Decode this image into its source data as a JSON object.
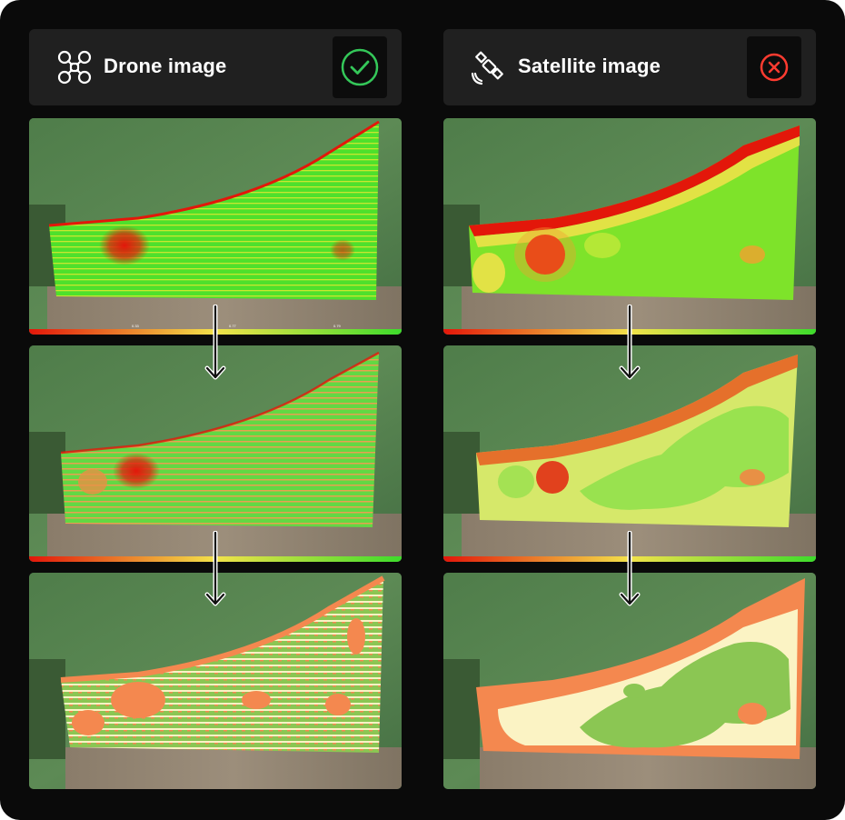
{
  "left_column": {
    "title": "Drone image",
    "icon": "drone-icon",
    "status": "check-icon",
    "status_color": "#34c759"
  },
  "right_column": {
    "title": "Satellite image",
    "icon": "satellite-icon",
    "status": "x-icon",
    "status_color": "#ff3b30"
  },
  "scale_labels": [
    "0.33",
    "0.77",
    "0.79"
  ],
  "colors": {
    "frame": "#0a0a0a",
    "header_bg": "#202020",
    "ndvi_low": "#e3170a",
    "ndvi_mid": "#f3e24a",
    "ndvi_high": "#3ddc2b",
    "zone_low": "#f4884f",
    "zone_mid": "#fbf3c4",
    "zone_high": "#8bc653"
  }
}
